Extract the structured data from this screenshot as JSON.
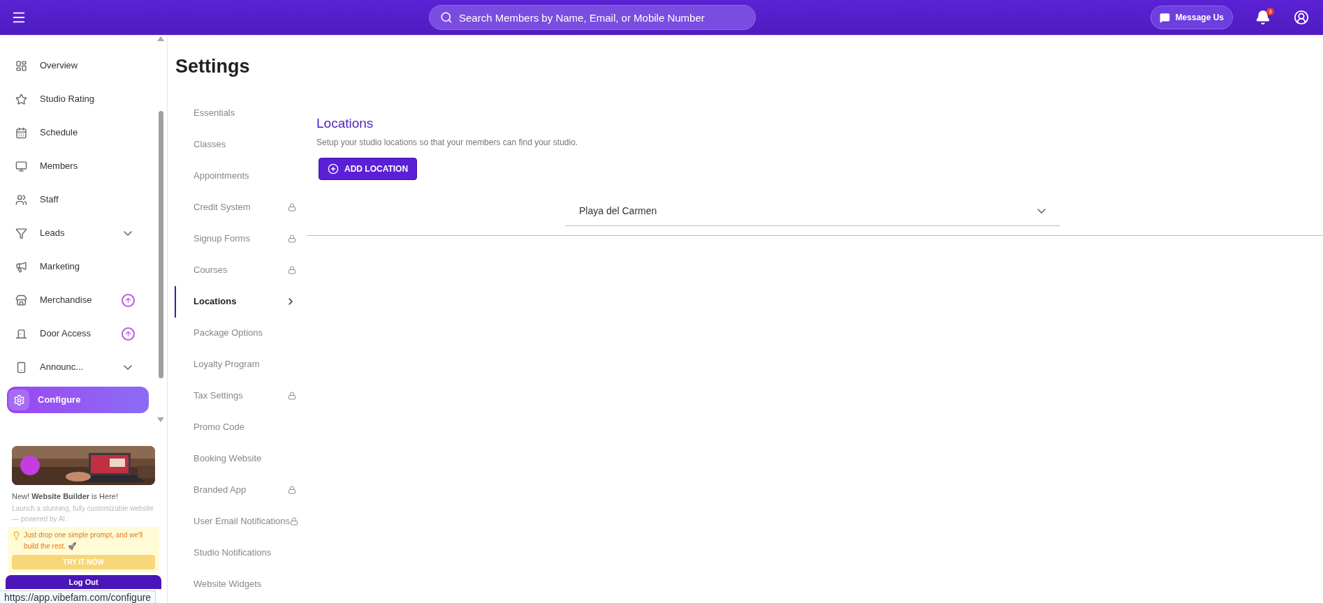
{
  "topbar": {
    "search": {
      "placeholder": "Search Members by Name, Email, or Mobile Number"
    },
    "message_button": "Message Us",
    "notifications_badge": "3"
  },
  "sidebar": {
    "items": [
      {
        "label": "Overview",
        "kind": "plain",
        "selected": false
      },
      {
        "label": "Studio Rating",
        "kind": "plain",
        "selected": false
      },
      {
        "label": "Schedule",
        "kind": "plain",
        "selected": false
      },
      {
        "label": "Members",
        "kind": "plain",
        "selected": false
      },
      {
        "label": "Staff",
        "kind": "plain",
        "selected": false
      },
      {
        "label": "Leads",
        "kind": "expandable",
        "selected": false
      },
      {
        "label": "Marketing",
        "kind": "plain",
        "selected": false
      },
      {
        "label": "Merchandise",
        "kind": "upgrade",
        "selected": false
      },
      {
        "label": "Door Access",
        "kind": "upgrade",
        "selected": false
      },
      {
        "label": "Announc...",
        "kind": "expandable",
        "selected": false
      },
      {
        "label": "Configure",
        "kind": "plain",
        "selected": true
      }
    ],
    "promo": {
      "headline": "New! **Website Builder** is Here!",
      "body": "Launch a stunning, fully customizable website — powered by AI.",
      "tip": "Just drop one simple prompt, and we'll build the rest. 🚀",
      "button": "TRY IT NOW"
    },
    "logout": "Log Out"
  },
  "settings": {
    "title": "Settings",
    "nav": [
      {
        "label": "Essentials",
        "locked": false,
        "selected": false
      },
      {
        "label": "Classes",
        "locked": false,
        "selected": false
      },
      {
        "label": "Appointments",
        "locked": false,
        "selected": false
      },
      {
        "label": "Credit System",
        "locked": true,
        "selected": false
      },
      {
        "label": "Signup Forms",
        "locked": true,
        "selected": false
      },
      {
        "label": "Courses",
        "locked": true,
        "selected": false
      },
      {
        "label": "Locations",
        "locked": false,
        "selected": true
      },
      {
        "label": "Package Options",
        "locked": false,
        "selected": false
      },
      {
        "label": "Loyalty Program",
        "locked": false,
        "selected": false
      },
      {
        "label": "Tax Settings",
        "locked": true,
        "selected": false
      },
      {
        "label": "Promo Code",
        "locked": false,
        "selected": false
      },
      {
        "label": "Booking Website",
        "locked": false,
        "selected": false
      },
      {
        "label": "Branded App",
        "locked": true,
        "selected": false
      },
      {
        "label": "User Email Notifications",
        "locked": true,
        "selected": false
      },
      {
        "label": "Studio Notifications",
        "locked": false,
        "selected": false
      },
      {
        "label": "Website Widgets",
        "locked": false,
        "selected": false
      }
    ]
  },
  "locations": {
    "title": "Locations",
    "description": "Setup your studio locations so that your members can find your studio.",
    "add_button": "ADD LOCATION",
    "items": [
      {
        "name": "Playa del Carmen",
        "expanded": false
      }
    ]
  },
  "status_url": "https://app.vibefam.com/configure"
}
